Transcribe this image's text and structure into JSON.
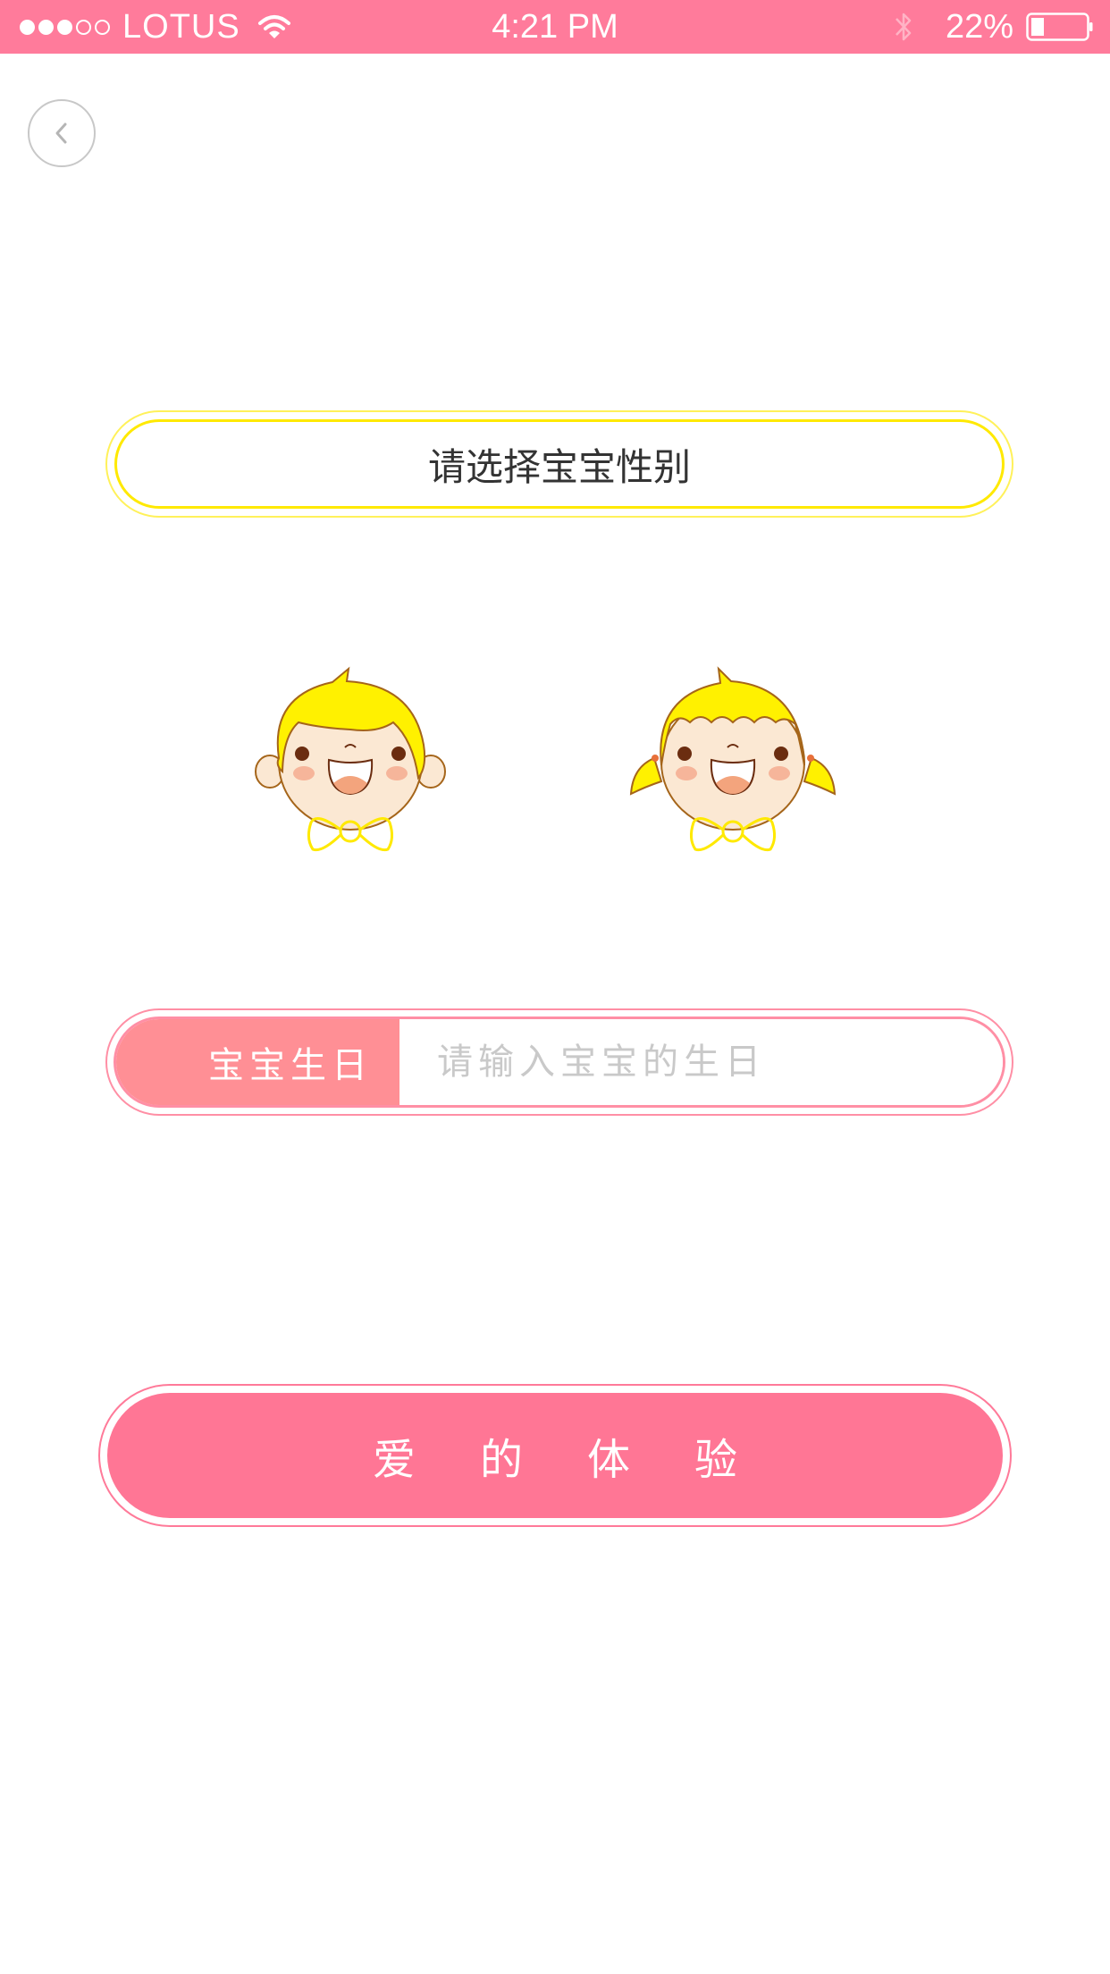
{
  "status_bar": {
    "carrier": "LOTUS",
    "time": "4:21 PM",
    "battery": "22%",
    "signal_bars_filled": 3,
    "signal_bars_total": 5,
    "battery_level": 0.22
  },
  "icons": {
    "back": "chevron-left-icon",
    "wifi": "wifi-icon",
    "bluetooth": "bluetooth-icon",
    "battery": "battery-icon"
  },
  "gender": {
    "prompt": "请选择宝宝性别"
  },
  "birthday": {
    "label": "宝宝生日",
    "placeholder": "请输入宝宝的生日",
    "value": ""
  },
  "submit": {
    "label": "爱的体验"
  },
  "colors": {
    "accent": "#ff7b9b",
    "pill_yellow": "#ffe900",
    "birthday_label_bg": "#ff8f95",
    "button": "#ff7695"
  }
}
